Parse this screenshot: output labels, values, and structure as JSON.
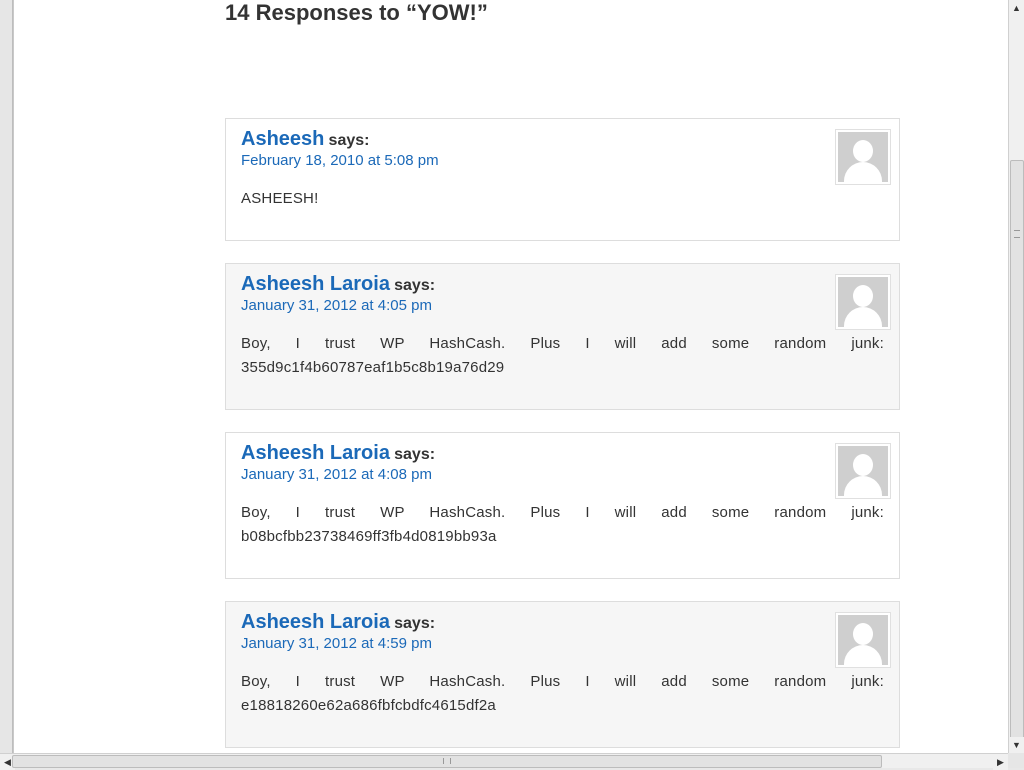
{
  "page": {
    "heading": "14 Responses to “YOW!”"
  },
  "comments": [
    {
      "author": "Asheesh",
      "says": "says:",
      "date": "February 18, 2010 at 5:08 pm",
      "text": "ASHEESH!"
    },
    {
      "author": "Asheesh Laroia",
      "says": "says:",
      "date": "January 31, 2012 at 4:05 pm",
      "text": "Boy, I trust WP HashCash. Plus I will add some random junk: 355d9c1f4b60787eaf1b5c8b19a76d29"
    },
    {
      "author": "Asheesh Laroia",
      "says": "says:",
      "date": "January 31, 2012 at 4:08 pm",
      "text": "Boy, I trust WP HashCash. Plus I will add some random junk: b08bcfbb23738469ff3fb4d0819bb93a"
    },
    {
      "author": "Asheesh Laroia",
      "says": "says:",
      "date": "January 31, 2012 at 4:59 pm",
      "text": "Boy, I trust WP HashCash. Plus I will add some random junk: e18818260e62a686fbfcbdfc4615df2a"
    }
  ],
  "icons": {
    "avatar": "default-avatar-icon",
    "scroll_up": "▲",
    "scroll_down": "▼",
    "scroll_left": "◀",
    "scroll_right": "▶"
  },
  "colors": {
    "link": "#1b69b8",
    "alt_bg": "#f6f6f6",
    "border": "#dddddd"
  }
}
